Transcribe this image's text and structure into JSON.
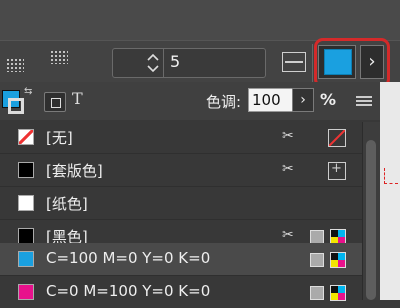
{
  "toolbar": {
    "stepper_value": "5",
    "swatch_color": "#1aa0e0",
    "expand_glyph": "›",
    "icons": [
      "grid-view-icon",
      "grid-view-icon",
      "rows-icon",
      "stepper-arrows-icon",
      "frame-fit-icon"
    ]
  },
  "panel": {
    "tint_label": "色调:",
    "tint_value": "100",
    "tint_arrow": "›",
    "percent_label": "%",
    "text_button": "T",
    "swatches": [
      {
        "label": "[无]",
        "type": "none"
      },
      {
        "label": "[套版色]",
        "type": "registration",
        "color": "#000000"
      },
      {
        "label": "[纸色]",
        "type": "paper",
        "color": "#ffffff"
      },
      {
        "label": "[黑色]",
        "type": "process",
        "color": "#000000"
      },
      {
        "label": "C=100 M=0 Y=0 K=0",
        "type": "process",
        "color": "#1aa0e0",
        "selected": true
      },
      {
        "label": "C=0 M=100 Y=0 K=0",
        "type": "process",
        "color": "#e8118c"
      }
    ]
  }
}
